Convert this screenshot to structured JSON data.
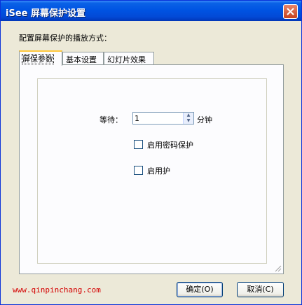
{
  "window": {
    "title": "iSee 屏幕保护设置"
  },
  "dialog": {
    "section_label": "配置屏幕保护的播放方式：",
    "tabs": [
      {
        "label": "屏保参数",
        "active": true
      },
      {
        "label": "基本设置",
        "active": false
      },
      {
        "label": "幻灯片效果",
        "active": false
      }
    ],
    "wait_label": "等待：",
    "wait_value": "1",
    "wait_unit": "分钟",
    "password_checkbox": {
      "label": "启用密码保护",
      "checked": false
    },
    "enable_checkbox": {
      "label": "启用护",
      "checked": false
    },
    "ok_label": "确定(O)",
    "cancel_label": "取消(C)",
    "footer_link": "www.qinpinchang.com"
  },
  "colors": {
    "titlebar": "#0054e3",
    "window_bg": "#ece9d8",
    "tab_highlight": "#ffc83c",
    "footer_link": "#d40000",
    "close_button": "#c9421e"
  },
  "icons": [
    "close-icon",
    "spin-up-icon",
    "spin-down-icon",
    "resize-grip-icon"
  ]
}
